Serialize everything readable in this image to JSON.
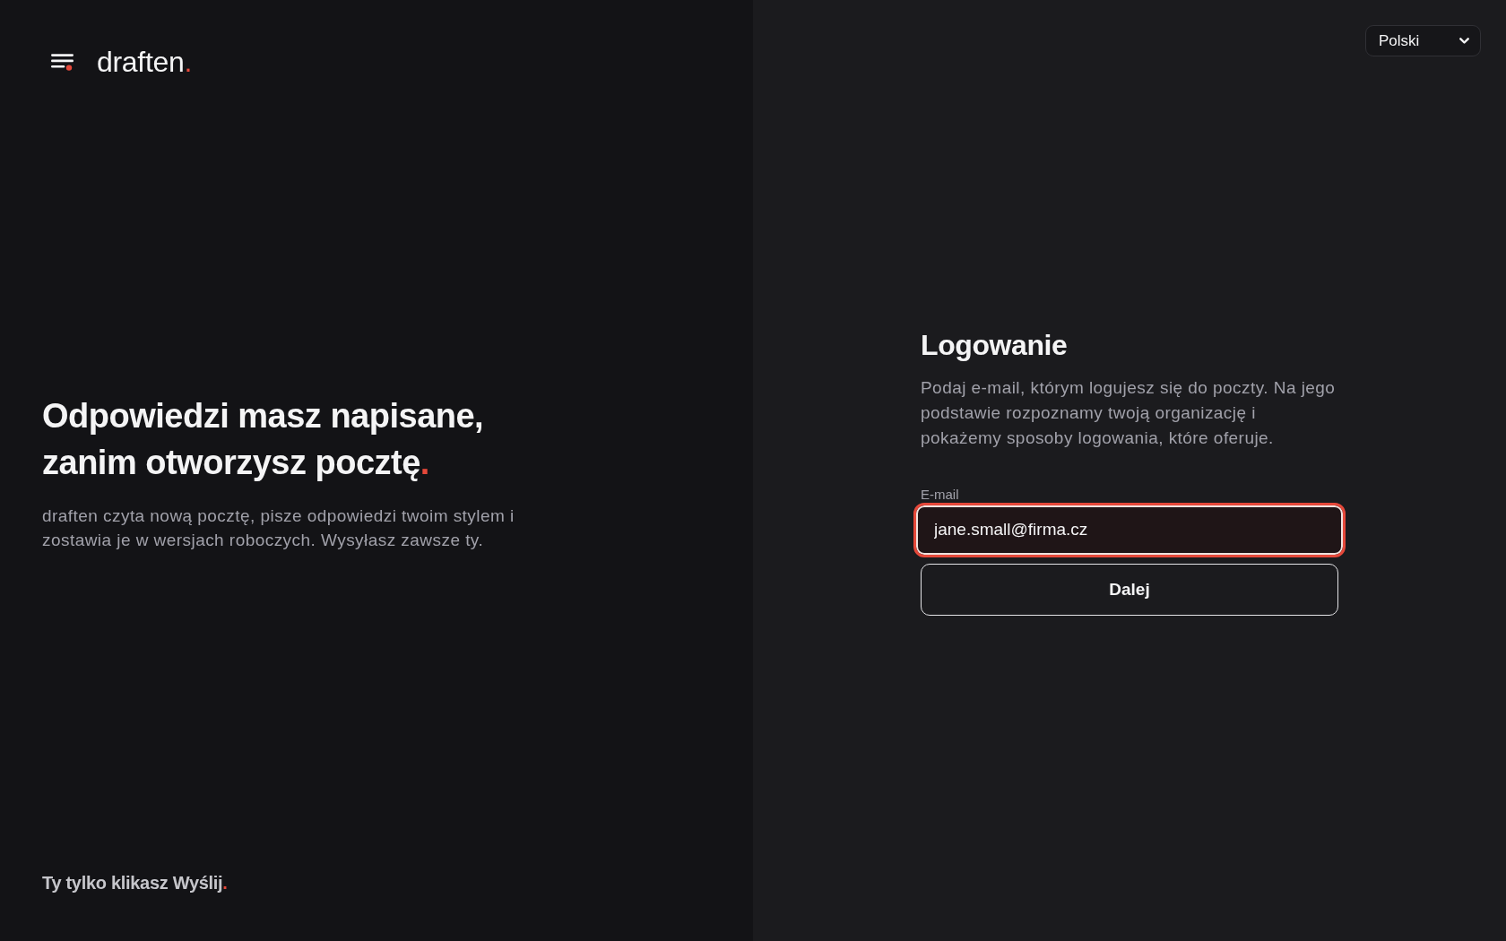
{
  "brand": {
    "name": "draften",
    "accent": "."
  },
  "language_select": {
    "value": "Polski"
  },
  "hero": {
    "headline": "Odpowiedzi masz napisane, zanim otworzysz pocztę",
    "headline_accent": ".",
    "description_lines": [
      "draften czyta nową pocztę, pisze odpowiedzi twoim stylem i",
      "zostawia je w wersjach roboczych. Wysyłasz zawsze ty."
    ]
  },
  "tagline": {
    "text": "Ty tylko klikasz Wyślij",
    "accent": "."
  },
  "login": {
    "title": "Logowanie",
    "description_lines": [
      "Podaj e-mail, którym logujesz się do poczty. Na jego",
      "podstawie rozpoznamy twoją organizację i",
      "pokażemy sposoby logowania, które oferuje."
    ],
    "email": {
      "label": "E-mail",
      "value": "jane.small@firma.cz",
      "focused": true
    },
    "submit": "Dalej"
  }
}
